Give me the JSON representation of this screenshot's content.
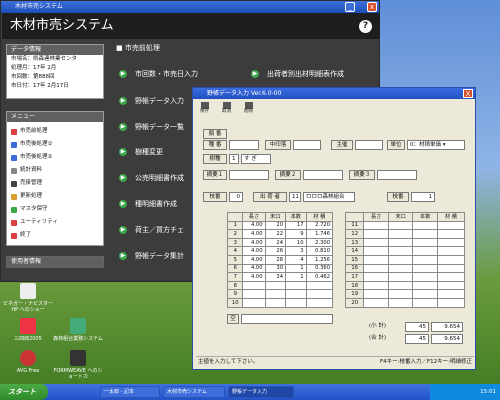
{
  "main_window": {
    "title": "木材市売システム",
    "banner": "木材市売システム",
    "help_icon": "?",
    "data_panel": {
      "header": "データ情報",
      "rows": [
        "市場名：県森連林業センタ",
        "処理月：17年 2月",
        "市回数：第888回",
        "市日付：17年 2月17日"
      ]
    },
    "menu_panel": {
      "header": "メニュー",
      "items": [
        {
          "label": "市売前処理",
          "color": "#d94040"
        },
        {
          "label": "市売後処理①",
          "color": "#3a6bd9"
        },
        {
          "label": "市売後処理②",
          "color": "#3a6bd9"
        },
        {
          "label": "統計資料",
          "color": "#888888"
        },
        {
          "label": "売掛管理",
          "color": "#444444"
        },
        {
          "label": "更新処理",
          "color": "#d9a030"
        },
        {
          "label": "マスタ保守",
          "color": "#3aa84a"
        },
        {
          "label": "ユーティリティ",
          "color": "#d94040"
        },
        {
          "label": "終了",
          "color": "#d94040"
        }
      ]
    },
    "user_panel": {
      "header": "使用者情報"
    },
    "section_title": "市売前処理",
    "buttons_left": [
      "市回数・市売日入力",
      "野帳データ入力",
      "野帳データ一覧",
      "樹種変更",
      "公売明細書作成",
      "種明細書作成",
      "荷主／買方チェ",
      "野帳データ集計"
    ],
    "buttons_right": [
      "出荷者別出材明細表作成"
    ]
  },
  "dialog": {
    "title": "野帳データ入力  Ver.6.0-00",
    "close": "X",
    "toolbar": [
      {
        "label": "保存",
        "icon": "save-icon"
      },
      {
        "label": "取消",
        "icon": "undo-icon"
      },
      {
        "label": "削除",
        "icon": "delete-icon"
      }
    ],
    "fields": {
      "jyunban_label": "順 番",
      "jyunban_value": "",
      "shubetsu_label": "種 番",
      "shubetsu_value": "",
      "kagamiban_label": "中印落",
      "kagamiban_value": "",
      "nushi_label": "主催",
      "nushi_value": "",
      "tanni_label": "単位",
      "tanni_value": "0：材積単価",
      "jushu_label": "樹種",
      "jushu_code": "1",
      "jushu_name": "す ぎ",
      "tekiyo1_label": "摘要１",
      "tekiyo2_label": "摘要２",
      "tekiyo3_label": "摘要３",
      "eda_label": "枝番",
      "eda_value": "0",
      "shukka_label": "出 荷 者",
      "shukka_code": "11",
      "shukka_name": "ロロロ森林組合",
      "honsu_label": "枝番",
      "honsu_value": "1"
    },
    "table_left": {
      "headers": [
        "",
        "長さ",
        "末口",
        "本数",
        "材 積"
      ],
      "rows": [
        [
          "1",
          "4.00",
          "20",
          "17",
          "2.720"
        ],
        [
          "2",
          "4.00",
          "22",
          "9",
          "1.746"
        ],
        [
          "3",
          "4.00",
          "24",
          "10",
          "2.300"
        ],
        [
          "4",
          "4.00",
          "26",
          "3",
          "0.810"
        ],
        [
          "5",
          "4.00",
          "28",
          "4",
          "1.256"
        ],
        [
          "6",
          "4.00",
          "30",
          "1",
          "0.360"
        ],
        [
          "7",
          "4.00",
          "34",
          "1",
          "0.462"
        ],
        [
          "8",
          "",
          "",
          "",
          ""
        ],
        [
          "9",
          "",
          "",
          "",
          ""
        ],
        [
          "10",
          "",
          "",
          "",
          ""
        ]
      ]
    },
    "table_right": {
      "headers": [
        "",
        "長さ",
        "末口",
        "本数",
        "材 積"
      ],
      "row_numbers": [
        "11",
        "12",
        "13",
        "14",
        "15",
        "16",
        "17",
        "18",
        "19",
        "20"
      ]
    },
    "summary": [
      {
        "label": "(小 計)",
        "count": "45",
        "volume": "9.654"
      },
      {
        "label": "(合 計)",
        "count": "45",
        "volume": "9.654"
      }
    ],
    "blank_label": "空",
    "status_left": "主値を入力して下さい。",
    "status_right": "F4キー:枝番入力／F12キー:明細修正"
  },
  "desktop_icons": [
    {
      "label": "三四郎2005"
    },
    {
      "label": "森林組合業務システム"
    },
    {
      "label": "AVG Free"
    },
    {
      "label": "FORMWEAVE ヘのショートカ"
    },
    {
      "label": "ビネガー・ナビスター HP へのショー"
    }
  ],
  "taskbar": {
    "start": "スタート",
    "items": [
      "一太郎 - 記本",
      "木材市売システム",
      "野帳データ入力"
    ],
    "clock": "15:01"
  }
}
